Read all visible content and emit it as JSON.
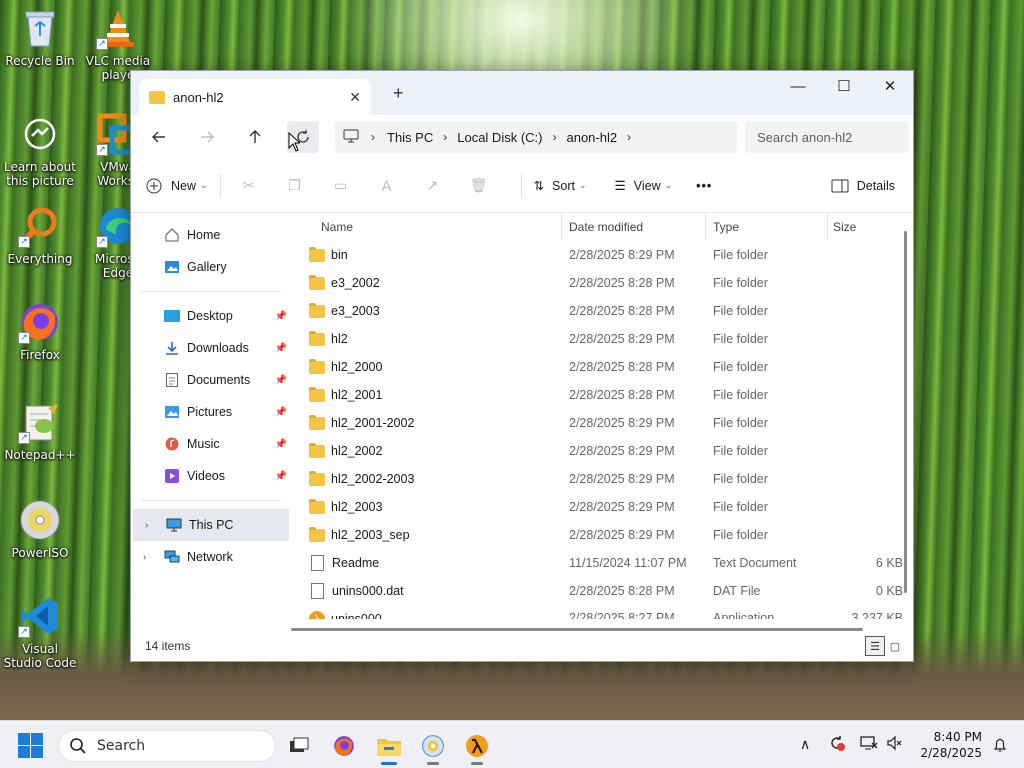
{
  "desktop": {
    "icons": [
      {
        "label": "Recycle Bin"
      },
      {
        "label": "VLC media playe"
      },
      {
        "label": "Learn about this picture"
      },
      {
        "label": "VMwa Workst"
      },
      {
        "label": "Everything"
      },
      {
        "label": "Microso Edge"
      },
      {
        "label": "Firefox"
      },
      {
        "label": "Notepad++"
      },
      {
        "label": "PowerISO"
      },
      {
        "label": "Visual Studio Code"
      }
    ]
  },
  "window": {
    "tab_title": "anon-hl2",
    "new_tab": "+",
    "address": {
      "crumbs": [
        "This PC",
        "Local Disk (C:)",
        "anon-hl2"
      ]
    },
    "search_placeholder": "Search anon-hl2",
    "toolbar": {
      "new_label": "New",
      "sort_label": "Sort",
      "view_label": "View",
      "more_label": "•••",
      "details_label": "Details"
    },
    "sidebar": {
      "items": [
        {
          "label": "Home"
        },
        {
          "label": "Gallery"
        },
        {
          "label": "Desktop"
        },
        {
          "label": "Downloads"
        },
        {
          "label": "Documents"
        },
        {
          "label": "Pictures"
        },
        {
          "label": "Music"
        },
        {
          "label": "Videos"
        },
        {
          "label": "This PC"
        },
        {
          "label": "Network"
        }
      ]
    },
    "columns": {
      "name": "Name",
      "date": "Date modified",
      "type": "Type",
      "size": "Size"
    },
    "files": [
      {
        "name": "bin",
        "date": "2/28/2025 8:29 PM",
        "type": "File folder",
        "size": ""
      },
      {
        "name": "e3_2002",
        "date": "2/28/2025 8:28 PM",
        "type": "File folder",
        "size": ""
      },
      {
        "name": "e3_2003",
        "date": "2/28/2025 8:28 PM",
        "type": "File folder",
        "size": ""
      },
      {
        "name": "hl2",
        "date": "2/28/2025 8:29 PM",
        "type": "File folder",
        "size": ""
      },
      {
        "name": "hl2_2000",
        "date": "2/28/2025 8:28 PM",
        "type": "File folder",
        "size": ""
      },
      {
        "name": "hl2_2001",
        "date": "2/28/2025 8:28 PM",
        "type": "File folder",
        "size": ""
      },
      {
        "name": "hl2_2001-2002",
        "date": "2/28/2025 8:29 PM",
        "type": "File folder",
        "size": ""
      },
      {
        "name": "hl2_2002",
        "date": "2/28/2025 8:29 PM",
        "type": "File folder",
        "size": ""
      },
      {
        "name": "hl2_2002-2003",
        "date": "2/28/2025 8:29 PM",
        "type": "File folder",
        "size": ""
      },
      {
        "name": "hl2_2003",
        "date": "2/28/2025 8:29 PM",
        "type": "File folder",
        "size": ""
      },
      {
        "name": "hl2_2003_sep",
        "date": "2/28/2025 8:29 PM",
        "type": "File folder",
        "size": ""
      },
      {
        "name": "Readme",
        "date": "11/15/2024 11:07 PM",
        "type": "Text Document",
        "size": "6 KB"
      },
      {
        "name": "unins000.dat",
        "date": "2/28/2025 8:28 PM",
        "type": "DAT File",
        "size": "0 KB"
      },
      {
        "name": "unins000",
        "date": "2/28/2025 8:27 PM",
        "type": "Application",
        "size": "3,237 KB"
      }
    ],
    "status": {
      "item_count": "14 items"
    }
  },
  "taskbar": {
    "search_label": "Search",
    "clock_time": "8:40 PM",
    "clock_date": "2/28/2025"
  },
  "colors": {
    "folder": "#f4c542",
    "accent": "#1a6fd8",
    "taskbar_bg": "#eef0f4"
  }
}
